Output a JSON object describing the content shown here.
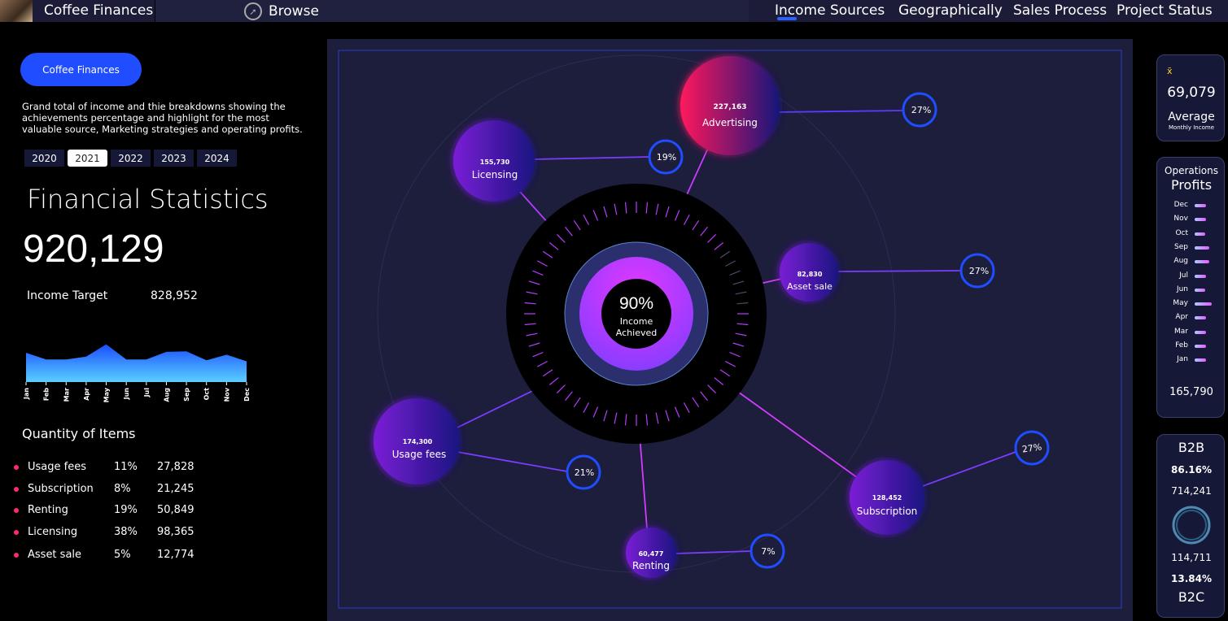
{
  "topbar": {
    "title": "Coffee Finances",
    "browse": "Browse",
    "nav": [
      "Income Sources",
      "Geographically",
      "Sales Process",
      "Project Status"
    ]
  },
  "left": {
    "pill": "Coffee Finances",
    "description": "Grand total of income and thie breakdowns showing the achievements percentage and highlight for the most valuable source, Marketing strategies and operating profits.",
    "years": [
      "2020",
      "2021",
      "2022",
      "2023",
      "2024"
    ],
    "active_year": "2021",
    "title": "Financial Statistics",
    "total": "920,129",
    "target_label": "Income Target",
    "target_value": "828,952",
    "months": [
      "Jan",
      "Feb",
      "Mar",
      "Apr",
      "May",
      "Jun",
      "Jul",
      "Aug",
      "Sep",
      "Oct",
      "Nov",
      "Dec"
    ],
    "qty_title": "Quantity of Items",
    "qty": [
      {
        "name": "Usage fees",
        "pct": "11%",
        "value": "27,828"
      },
      {
        "name": "Subscription",
        "pct": "8%",
        "value": "21,245"
      },
      {
        "name": "Renting",
        "pct": "19%",
        "value": "50,849"
      },
      {
        "name": "Licensing",
        "pct": "38%",
        "value": "98,365"
      },
      {
        "name": "Asset sale",
        "pct": "5%",
        "value": "12,774"
      }
    ]
  },
  "chart_data": {
    "type": "area",
    "categories": [
      "Jan",
      "Feb",
      "Mar",
      "Apr",
      "May",
      "Jun",
      "Jul",
      "Aug",
      "Sep",
      "Oct",
      "Nov",
      "Dec"
    ],
    "values": [
      62,
      48,
      48,
      54,
      80,
      48,
      48,
      64,
      65,
      46,
      58,
      44
    ],
    "ylim": [
      0,
      100
    ]
  },
  "center": {
    "center_pct": "90%",
    "center_label1": "Income",
    "center_label2": "Achieved",
    "sources": [
      {
        "name": "Advertising",
        "value": "227,163",
        "pct": "27%"
      },
      {
        "name": "Licensing",
        "value": "155,730",
        "pct": "19%"
      },
      {
        "name": "Asset sale",
        "value": "82,830",
        "pct": "27%"
      },
      {
        "name": "Usage fees",
        "value": "174,300",
        "pct": "21%"
      },
      {
        "name": "Subscription",
        "value": "128,452",
        "pct": "27%"
      },
      {
        "name": "Renting",
        "value": "60,477",
        "pct": "7%"
      }
    ]
  },
  "right": {
    "avg_mark": "x̄",
    "avg_value": "69,079",
    "avg_label": "Average",
    "avg_sub": "Monthly Income",
    "ops_title1": "Operations",
    "ops_title2": "Profits",
    "ops_months": [
      "Dec",
      "Nov",
      "Oct",
      "Sep",
      "Aug",
      "Jul",
      "Jun",
      "May",
      "Apr",
      "Mar",
      "Feb",
      "Jan"
    ],
    "ops_values": [
      0.45,
      0.45,
      0.4,
      0.55,
      0.55,
      0.45,
      0.4,
      0.65,
      0.45,
      0.45,
      0.45,
      0.45
    ],
    "ops_total": "165,790",
    "b2b_label": "B2B",
    "b2b_pct": "86.16%",
    "b2b_value": "714,241",
    "b2c_value": "114,711",
    "b2c_pct": "13.84%",
    "b2c_label": "B2C"
  },
  "colors": {
    "accent": "#1f4dff",
    "bubble": "#7a1fd6",
    "advertising": "#ff1a5c"
  }
}
